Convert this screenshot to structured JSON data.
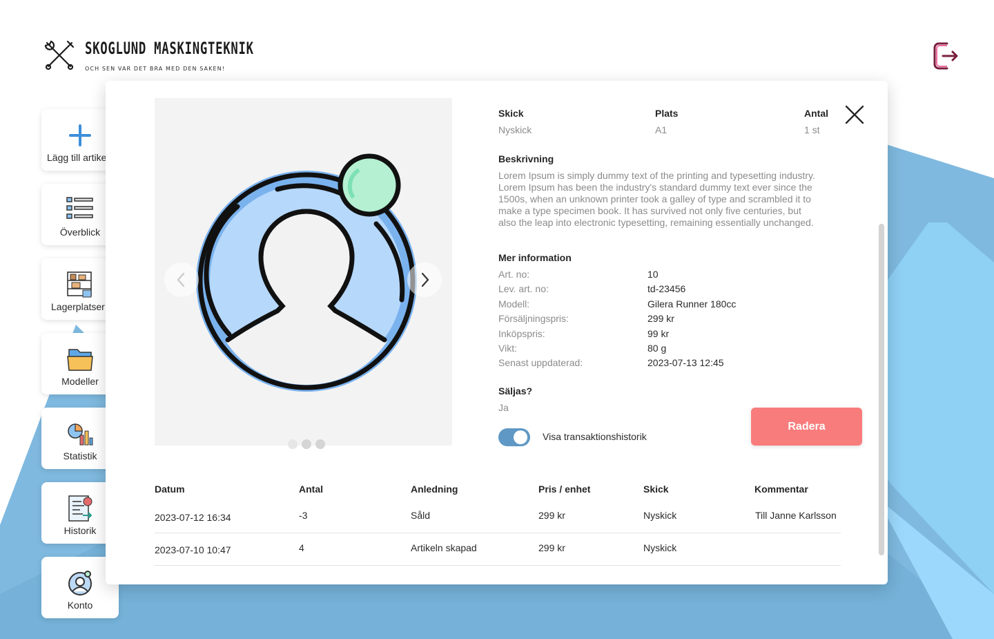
{
  "header": {
    "brand_title": "SKOGLUND MASKINGTEKNIK",
    "brand_tagline": "OCH SEN VAR DET BRA MED DEN SAKEN!",
    "logo_icon": "crossed-tools-icon",
    "logout_icon": "logout-icon"
  },
  "sidebar": {
    "items": [
      {
        "label": "Lägg till artikel",
        "icon": "plus-icon"
      },
      {
        "label": "Överblick",
        "icon": "list-icon"
      },
      {
        "label": "Lagerplatser",
        "icon": "shelves-icon"
      },
      {
        "label": "Modeller",
        "icon": "folder-icon"
      },
      {
        "label": "Statistik",
        "icon": "chart-icon"
      },
      {
        "label": "Historik",
        "icon": "history-icon"
      },
      {
        "label": "Konto",
        "icon": "account-icon"
      }
    ]
  },
  "modal": {
    "close_icon": "close-icon",
    "gallery": {
      "image_icon": "user-avatar-placeholder-icon",
      "dots": 3,
      "active_dot": 1
    },
    "fields": {
      "skick_label": "Skick",
      "skick_value": "Nyskick",
      "plats_label": "Plats",
      "plats_value": "A1",
      "antal_label": "Antal",
      "antal_value": "1 st"
    },
    "description_label": "Beskrivning",
    "description_lines": [
      "Lorem Ipsum is simply dummy text of the printing and typesetting industry.",
      "Lorem Ipsum has been the industry's standard dummy text ever since the",
      "1500s, when an unknown printer took a galley of type and scrambled it to",
      "make a type specimen book. It has survived not only five centuries, but",
      "also the leap into electronic typesetting, remaining essentially unchanged."
    ],
    "more_info_label": "Mer information",
    "more_info": [
      {
        "key": "Art. no:",
        "value": "10"
      },
      {
        "key": "Lev. art. no:",
        "value": "td-23456"
      },
      {
        "key": "Modell:",
        "value": "Gilera Runner 180cc"
      },
      {
        "key": "Försäljningspris:",
        "value": "299 kr"
      },
      {
        "key": "Inköpspris:",
        "value": "99 kr"
      },
      {
        "key": "Vikt:",
        "value": "80 g"
      },
      {
        "key": "Senast uppdaterad:",
        "value": "2023-07-13 12:45"
      }
    ],
    "sold_label": "Säljas?",
    "sold_value": "Ja",
    "toggle_label": "Visa transaktionshistorik",
    "toggle_on": true,
    "delete_label": "Radera",
    "colors": {
      "delete": "#f97c7c",
      "toggle": "#5f98c4",
      "background_blue": "#7fb9df"
    },
    "history": {
      "columns": [
        "Datum",
        "Antal",
        "Anledning",
        "Pris / enhet",
        "Skick",
        "Kommentar"
      ],
      "rows": [
        [
          "2023-07-12 16:34",
          "-3",
          "Såld",
          "299 kr",
          "Nyskick",
          "Till Janne Karlsson"
        ],
        [
          "2023-07-10 10:47",
          "4",
          "Artikeln skapad",
          "299 kr",
          "Nyskick",
          ""
        ]
      ]
    }
  }
}
